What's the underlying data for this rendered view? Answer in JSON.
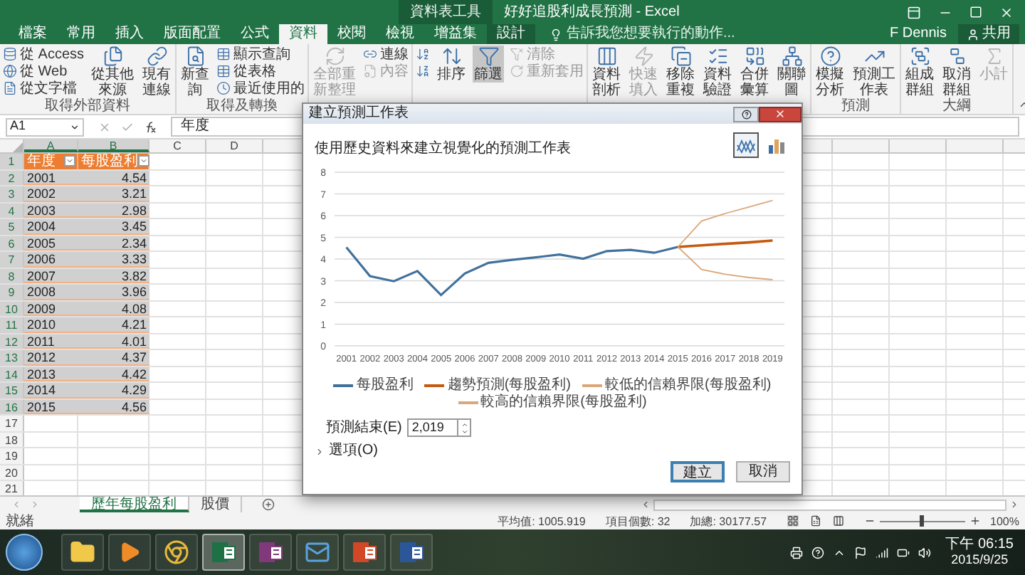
{
  "window": {
    "title": "好好追股利成長預測 - Excel",
    "context_group": "資料表工具"
  },
  "ribbon_tabs": [
    {
      "label": "檔案",
      "contextual": false,
      "selected": false
    },
    {
      "label": "常用",
      "contextual": false,
      "selected": false
    },
    {
      "label": "插入",
      "contextual": false,
      "selected": false
    },
    {
      "label": "版面配置",
      "contextual": false,
      "selected": false
    },
    {
      "label": "公式",
      "contextual": false,
      "selected": false
    },
    {
      "label": "資料",
      "contextual": false,
      "selected": true
    },
    {
      "label": "校閱",
      "contextual": false,
      "selected": false
    },
    {
      "label": "檢視",
      "contextual": false,
      "selected": false
    },
    {
      "label": "增益集",
      "contextual": false,
      "selected": false
    },
    {
      "label": "設計",
      "contextual": true,
      "selected": false
    }
  ],
  "tell_me": {
    "placeholder": "告訴我您想要執行的動作..."
  },
  "user": "F Dennis",
  "share_button": "共用",
  "ribbon_groups": [
    {
      "label": "取得外部資料",
      "items": [
        {
          "kind": "small",
          "label": "從 Access",
          "disabled": false
        },
        {
          "kind": "small",
          "label": "從 Web",
          "disabled": false
        },
        {
          "kind": "small",
          "label": "從文字檔",
          "disabled": false
        },
        {
          "kind": "large",
          "label": "從其他來源",
          "disabled": false
        },
        {
          "kind": "large",
          "label": "現有連線",
          "disabled": false
        }
      ]
    },
    {
      "label": "取得及轉換",
      "items": [
        {
          "kind": "large",
          "label": "新查詢",
          "disabled": false
        },
        {
          "kind": "small",
          "label": "顯示查詢",
          "disabled": false
        },
        {
          "kind": "small",
          "label": "從表格",
          "disabled": false
        },
        {
          "kind": "small",
          "label": "最近使用的",
          "disabled": false
        }
      ]
    },
    {
      "items": [
        {
          "kind": "large",
          "label": "全部重新整理",
          "disabled": true
        },
        {
          "kind": "small",
          "label": "連線",
          "disabled": false
        },
        {
          "kind": "small",
          "label": "內容",
          "disabled": true
        }
      ]
    },
    {
      "items": [
        {
          "kind": "small",
          "disabled": false,
          "pressed": false
        },
        {
          "kind": "small",
          "disabled": false,
          "pressed": false
        },
        {
          "kind": "large",
          "label": "排序",
          "disabled": false,
          "pressed": false
        },
        {
          "kind": "large",
          "label": "篩選",
          "disabled": false,
          "pressed": true
        },
        {
          "kind": "small",
          "label": "清除",
          "disabled": true,
          "pressed": false
        },
        {
          "kind": "small",
          "label": "重新套用",
          "disabled": true,
          "pressed": false
        }
      ]
    },
    {
      "items": [
        {
          "kind": "large",
          "label": "資料剖析",
          "disabled": false
        },
        {
          "kind": "large",
          "label": "快速填入",
          "disabled": true
        },
        {
          "kind": "large",
          "label": "移除重複",
          "disabled": false
        },
        {
          "kind": "large",
          "label": "資料驗證",
          "disabled": false
        },
        {
          "kind": "large",
          "label": "合併彙算",
          "disabled": false
        },
        {
          "kind": "large",
          "label": "關聯圖",
          "disabled": false
        }
      ]
    },
    {
      "label": "預測",
      "items": [
        {
          "kind": "large",
          "label": "模擬分析",
          "disabled": false
        },
        {
          "kind": "large",
          "label": "預測工作表",
          "disabled": false
        }
      ]
    },
    {
      "label": "大綱",
      "items": [
        {
          "kind": "large",
          "label": "組成群組",
          "disabled": false
        },
        {
          "kind": "large",
          "label": "取消群組",
          "disabled": false
        },
        {
          "kind": "large",
          "label": "小計",
          "disabled": true
        }
      ]
    }
  ],
  "name_box": "A1",
  "formula": "年度",
  "columns": [
    {
      "label": "A",
      "selected": true
    },
    {
      "label": "B",
      "selected": true
    },
    {
      "label": "C",
      "selected": false
    },
    {
      "label": "D",
      "selected": false
    }
  ],
  "rows": [
    {
      "number": "1",
      "kind": "header",
      "selected": true,
      "cells": [
        "年度",
        "每股盈利"
      ]
    },
    {
      "number": "2",
      "kind": "data",
      "selected": true,
      "cells": [
        "2001",
        "4.54"
      ]
    },
    {
      "number": "3",
      "kind": "data",
      "selected": true,
      "cells": [
        "2002",
        "3.21"
      ]
    },
    {
      "number": "4",
      "kind": "data",
      "selected": true,
      "cells": [
        "2003",
        "2.98"
      ]
    },
    {
      "number": "5",
      "kind": "data",
      "selected": true,
      "cells": [
        "2004",
        "3.45"
      ]
    },
    {
      "number": "6",
      "kind": "data",
      "selected": true,
      "cells": [
        "2005",
        "2.34"
      ]
    },
    {
      "number": "7",
      "kind": "data",
      "selected": true,
      "cells": [
        "2006",
        "3.33"
      ]
    },
    {
      "number": "8",
      "kind": "data",
      "selected": true,
      "cells": [
        "2007",
        "3.82"
      ]
    },
    {
      "number": "9",
      "kind": "data",
      "selected": true,
      "cells": [
        "2008",
        "3.96"
      ]
    },
    {
      "number": "10",
      "kind": "data",
      "selected": true,
      "cells": [
        "2009",
        "4.08"
      ]
    },
    {
      "number": "11",
      "kind": "data",
      "selected": true,
      "cells": [
        "2010",
        "4.21"
      ]
    },
    {
      "number": "12",
      "kind": "data",
      "selected": true,
      "cells": [
        "2011",
        "4.01"
      ]
    },
    {
      "number": "13",
      "kind": "data",
      "selected": true,
      "cells": [
        "2012",
        "4.37"
      ]
    },
    {
      "number": "14",
      "kind": "data",
      "selected": true,
      "cells": [
        "2013",
        "4.42"
      ]
    },
    {
      "number": "15",
      "kind": "data",
      "selected": true,
      "cells": [
        "2014",
        "4.29"
      ]
    },
    {
      "number": "16",
      "kind": "data",
      "selected": true,
      "cells": [
        "2015",
        "4.56"
      ]
    },
    {
      "number": "17",
      "kind": "empty",
      "selected": false
    },
    {
      "number": "18",
      "kind": "empty",
      "selected": false
    },
    {
      "number": "19",
      "kind": "empty",
      "selected": false
    },
    {
      "number": "20",
      "kind": "empty",
      "selected": false
    },
    {
      "number": "21",
      "kind": "empty",
      "selected": false
    }
  ],
  "dialog": {
    "title": "建立預測工作表",
    "description": "使用歷史資料來建立視覺化的預測工作表",
    "chart_types": [
      {
        "kind": "line",
        "selected": true
      },
      {
        "kind": "column",
        "selected": false
      }
    ],
    "chart_data": {
      "type": "line",
      "grid": true,
      "categories": [
        "2001",
        "2002",
        "2003",
        "2004",
        "2005",
        "2006",
        "2007",
        "2008",
        "2009",
        "2010",
        "2011",
        "2012",
        "2013",
        "2014",
        "2015",
        "2016",
        "2017",
        "2018",
        "2019"
      ],
      "ylim": [
        0,
        8
      ],
      "yticks": [
        0,
        1,
        2,
        3,
        4,
        5,
        6,
        7,
        8
      ],
      "series": [
        {
          "name": "每股盈利",
          "color": "#41719c",
          "values": [
            4.54,
            3.21,
            2.98,
            3.45,
            2.34,
            3.33,
            3.82,
            3.96,
            4.08,
            4.21,
            4.01,
            4.37,
            4.42,
            4.29,
            4.56,
            null,
            null,
            null,
            null
          ]
        },
        {
          "name": "趨勢預測(每股盈利)",
          "color": "#c55a11",
          "values": [
            null,
            null,
            null,
            null,
            null,
            null,
            null,
            null,
            null,
            null,
            null,
            null,
            null,
            null,
            4.56,
            4.63,
            4.7,
            4.77,
            4.85
          ]
        },
        {
          "name": "較低的信賴界限(每股盈利)",
          "color": "#dba77a",
          "values": [
            null,
            null,
            null,
            null,
            null,
            null,
            null,
            null,
            null,
            null,
            null,
            null,
            null,
            null,
            4.56,
            3.52,
            3.3,
            3.15,
            3.05
          ]
        },
        {
          "name": "較高的信賴界限(每股盈利)",
          "color": "#dba77a",
          "values": [
            null,
            null,
            null,
            null,
            null,
            null,
            null,
            null,
            null,
            null,
            null,
            null,
            null,
            null,
            4.56,
            5.75,
            6.1,
            6.4,
            6.7
          ]
        }
      ]
    },
    "forecast_end": {
      "label": "預測結束(E)",
      "value": "2,019"
    },
    "options": {
      "label": "選項(O)",
      "expanded": false
    },
    "buttons": [
      {
        "label": "建立",
        "default": true
      },
      {
        "label": "取消",
        "default": false
      }
    ]
  },
  "sheet_tabs": [
    {
      "label": "歷年每股盈利",
      "selected": true
    },
    {
      "label": "股價",
      "selected": false
    }
  ],
  "status_bar": {
    "mode": "就緒",
    "stats": [
      "平均值: 1005.919",
      "項目個數: 32",
      "加總: 30177.57"
    ],
    "zoom": {
      "level": 0.5,
      "reading": "100%"
    }
  },
  "taskbar": {
    "apps": [
      {
        "kind": "folder",
        "selected": false
      },
      {
        "kind": "media",
        "selected": false
      },
      {
        "kind": "browser",
        "selected": false
      },
      {
        "kind": "excel",
        "selected": true
      },
      {
        "kind": "onenote",
        "selected": false
      },
      {
        "kind": "outlook",
        "selected": false
      },
      {
        "kind": "powerpoint",
        "selected": false
      },
      {
        "kind": "word",
        "selected": false
      }
    ],
    "time": "下午 06:15",
    "date": "2015/9/25"
  }
}
